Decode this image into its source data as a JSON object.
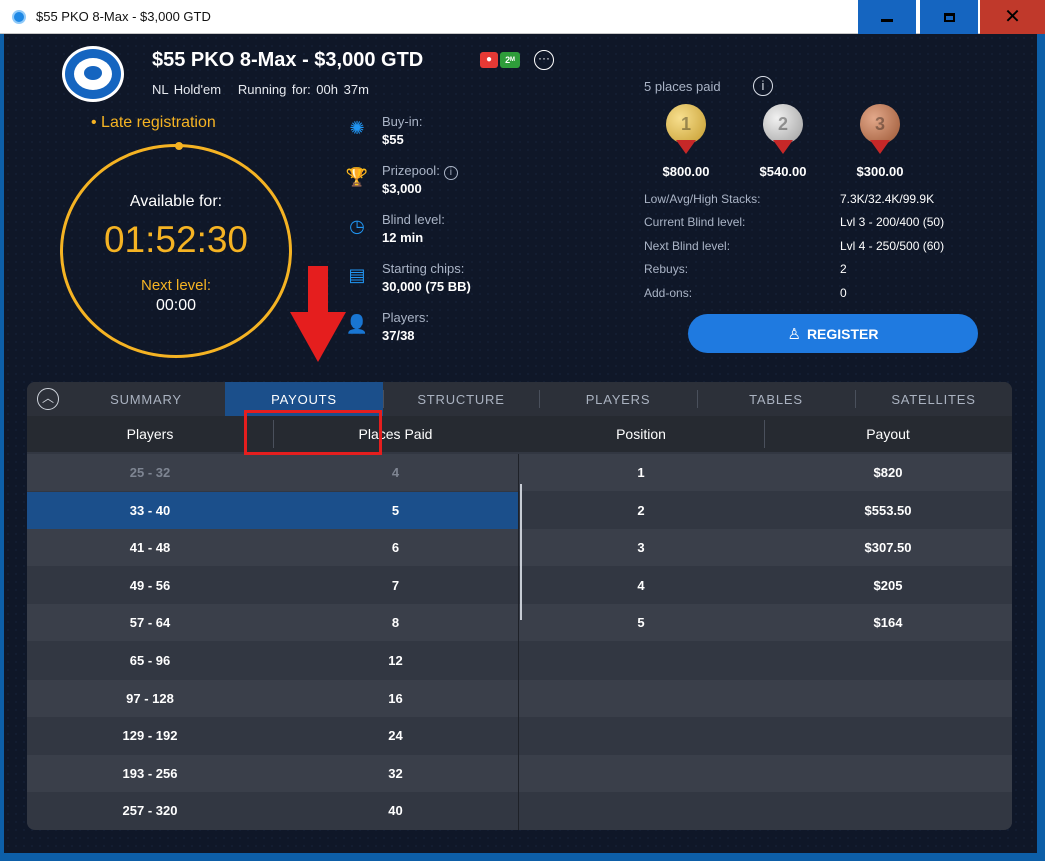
{
  "window": {
    "title": "$55 PKO 8-Max - $3,000 GTD",
    "close_glyph": "✕"
  },
  "header": {
    "title": "$55 PKO 8-Max - $3,000 GTD",
    "badge_2x": "2ᴹ",
    "game": "NL Hold'em",
    "running": "Running for: 00h 37m"
  },
  "late_registration": "• Late registration",
  "timer": {
    "label": "Available for:",
    "time": "01:52:30",
    "next_label": "Next level:",
    "next_value": "00:00"
  },
  "info": [
    {
      "icon": "chip-icon",
      "glyph": "✺",
      "label": "Buy-in:",
      "value": "$55"
    },
    {
      "icon": "trophy-icon",
      "glyph": "🏆",
      "label": "Prizepool:",
      "value": "$3,000"
    },
    {
      "icon": "clock-icon",
      "glyph": "◷",
      "label": "Blind level:",
      "value": "12 min"
    },
    {
      "icon": "chips-stack-icon",
      "glyph": "▤",
      "label": "Starting chips:",
      "value": "30,000 (75 BB)"
    },
    {
      "icon": "player-icon",
      "glyph": "👤",
      "label": "Players:",
      "value": "37/38"
    }
  ],
  "prizes": {
    "places_paid": "5 places paid",
    "medals": [
      {
        "rank": "1",
        "amount": "$800.00"
      },
      {
        "rank": "2",
        "amount": "$540.00"
      },
      {
        "rank": "3",
        "amount": "$300.00"
      }
    ],
    "stats": [
      {
        "label": "Low/Avg/High Stacks:",
        "value": "7.3K/32.4K/99.9K"
      },
      {
        "label": "Current Blind level:",
        "value": "Lvl 3 - 200/400 (50)"
      },
      {
        "label": "Next Blind level:",
        "value": "Lvl 4 - 250/500 (60)"
      },
      {
        "label": "Rebuys:",
        "value": "2"
      },
      {
        "label": "Add-ons:",
        "value": "0"
      }
    ]
  },
  "register_label": "REGISTER",
  "tabs": [
    "SUMMARY",
    "PAYOUTS",
    "STRUCTURE",
    "PLAYERS",
    "TABLES",
    "SATELLITES"
  ],
  "active_tab": "PAYOUTS",
  "table": {
    "headers": [
      "Players",
      "Places Paid",
      "Position",
      "Payout"
    ],
    "ranges": [
      {
        "players": "25 - 32",
        "places": "4"
      },
      {
        "players": "33 - 40",
        "places": "5"
      },
      {
        "players": "41 - 48",
        "places": "6"
      },
      {
        "players": "49 - 56",
        "places": "7"
      },
      {
        "players": "57 - 64",
        "places": "8"
      },
      {
        "players": "65 - 96",
        "places": "12"
      },
      {
        "players": "97 - 128",
        "places": "16"
      },
      {
        "players": "129 - 192",
        "places": "24"
      },
      {
        "players": "193 - 256",
        "places": "32"
      },
      {
        "players": "257 - 320",
        "places": "40"
      }
    ],
    "payouts": [
      {
        "position": "1",
        "payout": "$820"
      },
      {
        "position": "2",
        "payout": "$553.50"
      },
      {
        "position": "3",
        "payout": "$307.50"
      },
      {
        "position": "4",
        "payout": "$205"
      },
      {
        "position": "5",
        "payout": "$164"
      }
    ],
    "selected_row": 1,
    "dim_row": 0
  },
  "colors": {
    "accent": "#f5b323",
    "primary": "#1f7ae0",
    "selected": "#1b4f8b",
    "annotation": "#e51e1e"
  }
}
